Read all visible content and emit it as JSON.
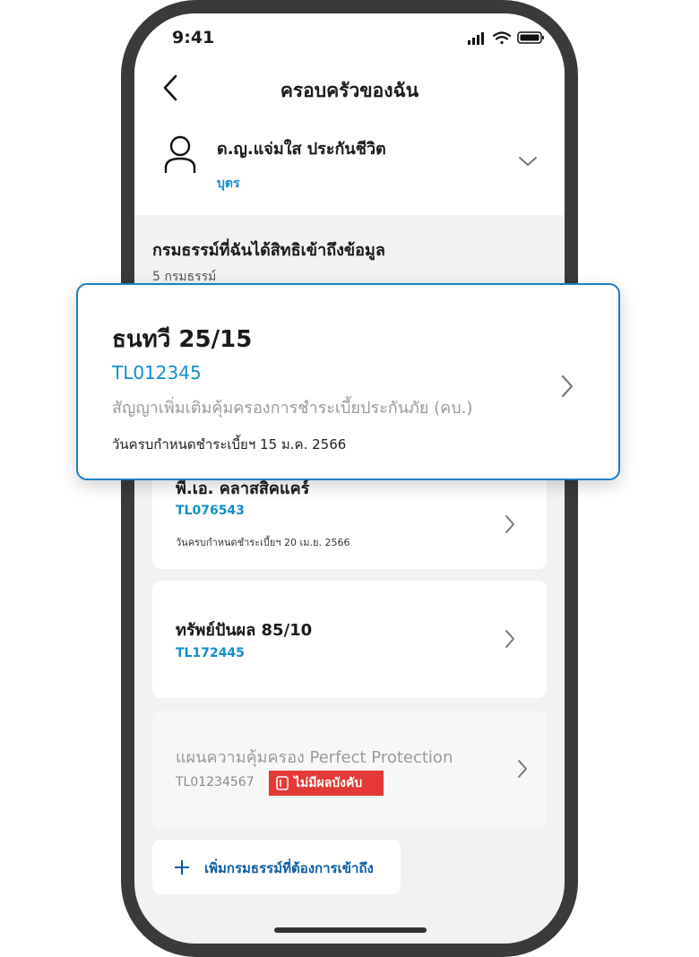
{
  "status_bar": {
    "time": "9:41"
  },
  "header": {
    "title": "ครอบครัวของฉัน"
  },
  "member": {
    "name": "ด.ญ.แจ่มใส ประกันชีวิต",
    "relation": "บุตร"
  },
  "section": {
    "title": "กรมธรรม์ที่ฉันได้สิทธิเข้าถึงข้อมูล",
    "count": "5 กรมธรรม์"
  },
  "highlight_card": {
    "name": "ธนทวี 25/15",
    "policy_no": "TL012345",
    "description": "สัญญาเพิ่มเติมคุ้มครองการชำระเบี้ยประกันภัย (คบ.)",
    "due": "วันครบกำหนดชำระเบี้ยฯ 15 ม.ค. 2566"
  },
  "policies": [
    {
      "name": "พี.เอ. คลาสสิคแคร์",
      "policy_no": "TL076543",
      "due": "วันครบกำหนดชำระเบี้ยฯ 20 เม.ย. 2566"
    },
    {
      "name": "ทรัพย์ปันผล 85/10",
      "policy_no": "TL172445"
    },
    {
      "name": "แผนความคุ้มครอง Perfect Protection",
      "policy_no": "TL01234567",
      "badge": "ไม่มีผลบังคับ"
    }
  ],
  "add_button": {
    "label": "เพิ่มกรมธรรม์ที่ต้องการเข้าถึง"
  },
  "colors": {
    "accent": "#0f8fce",
    "badge": "#e53935",
    "highlight_border": "#1a7fc4"
  }
}
